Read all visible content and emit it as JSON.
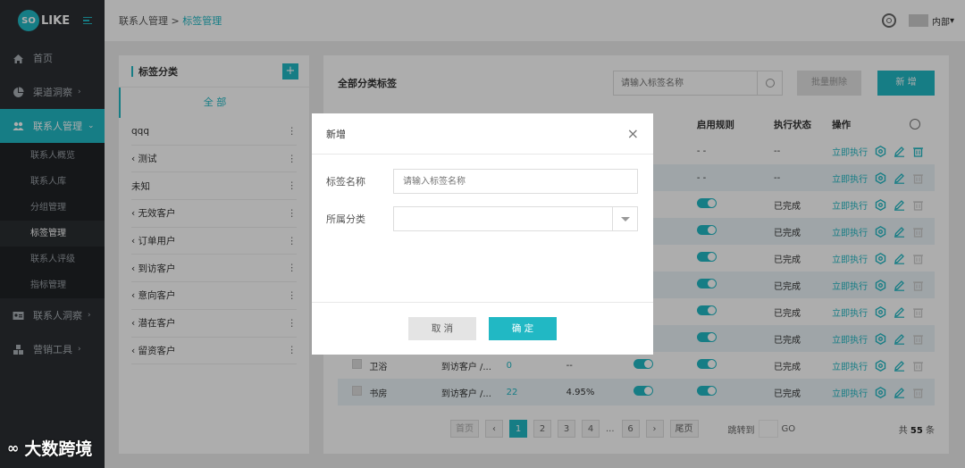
{
  "brand": {
    "logo_circle": "SO",
    "logo_text": "LIKE",
    "accent": "#21b8c4"
  },
  "header": {
    "breadcrumb_parent": "联系人管理",
    "breadcrumb_sep": " > ",
    "breadcrumb_current": "标签管理",
    "user": "内部",
    "user_caret": "▾"
  },
  "sidebar": {
    "items": [
      {
        "label": "首页",
        "icon": "home-icon"
      },
      {
        "label": "渠道洞察",
        "icon": "pie-chart-icon",
        "chev": "›"
      },
      {
        "label": "联系人管理",
        "icon": "users-icon",
        "chev": "⌄",
        "active": true
      },
      {
        "label": "联系人洞察",
        "icon": "id-card-icon",
        "chev": "›"
      },
      {
        "label": "营销工具",
        "icon": "cubes-icon",
        "chev": "›"
      }
    ],
    "sub_items": [
      "联系人概览",
      "联系人库",
      "分组管理",
      "标签管理",
      "联系人评级",
      "指标管理"
    ]
  },
  "left_panel": {
    "title": "标签分类",
    "add": "+",
    "all": "全 部",
    "categories": [
      "qqq",
      "‹ 测试",
      "未知",
      "‹ 无效客户",
      "‹ 订单用户",
      "‹ 到访客户",
      "‹ 意向客户",
      "‹ 潜在客户",
      "‹ 留资客户"
    ],
    "menu_dots": "⋮"
  },
  "right_panel": {
    "title": "全部分类标签",
    "search_placeholder": "请输入标签名称",
    "batch_delete": "批量删除",
    "new": "新 增",
    "columns": {
      "rule": "启用规则",
      "exec": "执行状态",
      "ops": "操作"
    },
    "rows": [
      {
        "name": "",
        "cat": "",
        "count": "",
        "pct": "",
        "status": false,
        "rule": "- -",
        "exec": "--",
        "run": "立即执行"
      },
      {
        "name": "",
        "cat": "",
        "count": "",
        "pct": "",
        "status": false,
        "rule": "- -",
        "exec": "--",
        "run": "立即执行"
      },
      {
        "name": "",
        "cat": "",
        "count": "",
        "pct": "",
        "status": false,
        "rule": "on",
        "exec": "已完成",
        "run": "立即执行"
      },
      {
        "name": "",
        "cat": "",
        "count": "",
        "pct": "",
        "status": false,
        "rule": "on",
        "exec": "已完成",
        "run": "立即执行"
      },
      {
        "name": "",
        "cat": "",
        "count": "",
        "pct": "",
        "status": false,
        "rule": "on",
        "exec": "已完成",
        "run": "立即执行"
      },
      {
        "name": "",
        "cat": "",
        "count": "",
        "pct": "",
        "status": false,
        "rule": "on",
        "exec": "已完成",
        "run": "立即执行"
      },
      {
        "name": "",
        "cat": "",
        "count": "",
        "pct": "",
        "status": false,
        "rule": "on",
        "exec": "已完成",
        "run": "立即执行"
      },
      {
        "name": "",
        "cat": "",
        "count": "",
        "pct": "",
        "status": false,
        "rule": "on",
        "exec": "已完成",
        "run": "立即执行"
      },
      {
        "name": "卫浴",
        "cat": "到访客户 /...",
        "count": "0",
        "pct": "--",
        "status": true,
        "rule": "on",
        "exec": "已完成",
        "run": "立即执行"
      },
      {
        "name": "书房",
        "cat": "到访客户 /...",
        "count": "22",
        "pct": "4.95%",
        "status": true,
        "rule": "on",
        "exec": "已完成",
        "run": "立即执行"
      }
    ],
    "pager": {
      "first": "首页",
      "prev": "‹",
      "pages": [
        "1",
        "2",
        "3",
        "4"
      ],
      "ellipsis": "...",
      "last_num": "6",
      "next": "›",
      "last": "尾页",
      "jump_label": "跳转到",
      "go": "GO",
      "total_prefix": "共",
      "total": "55",
      "total_suffix": "条"
    }
  },
  "modal": {
    "title": "新增",
    "close": "×",
    "name_label": "标签名称",
    "name_placeholder": "请输入标签名称",
    "cat_label": "所属分类",
    "cancel": "取 消",
    "ok": "确 定"
  },
  "watermark": {
    "mark": "∞",
    "text": "大数跨境"
  }
}
